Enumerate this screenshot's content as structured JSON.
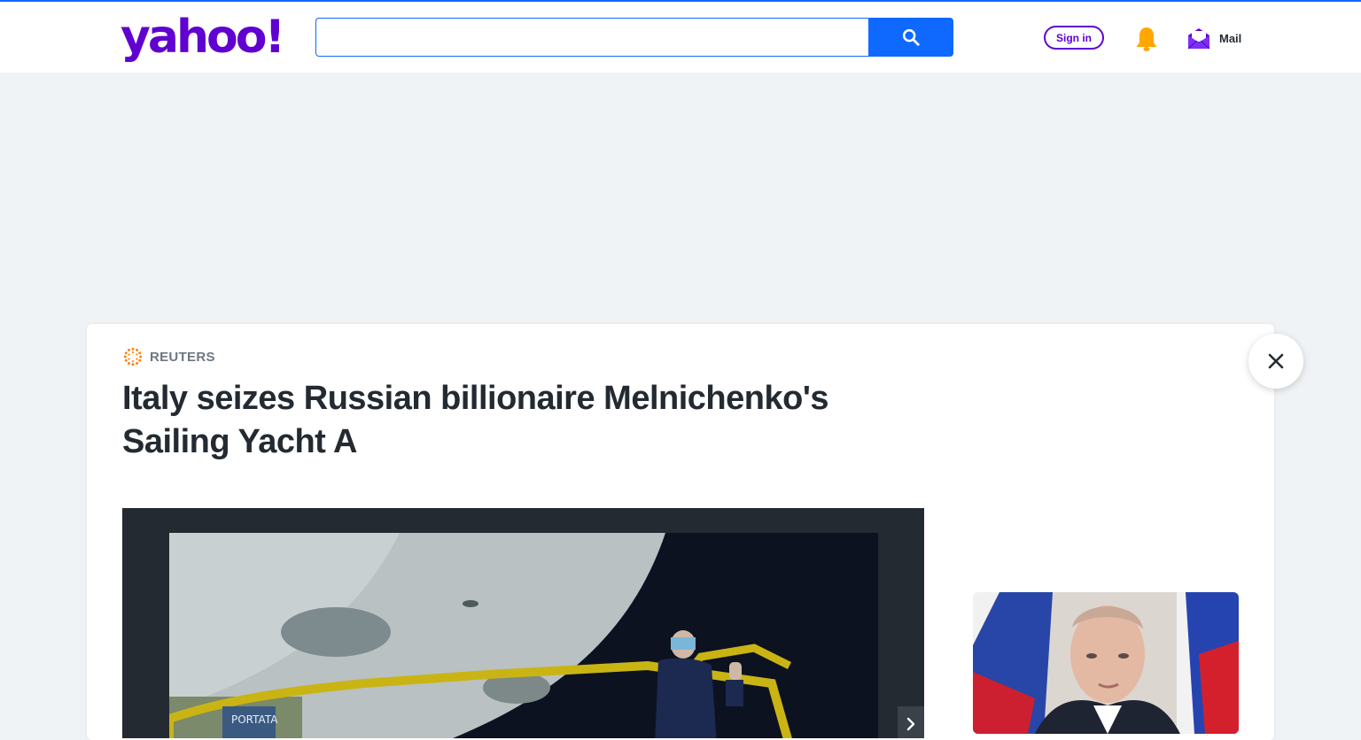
{
  "header": {
    "logo_text": "yahoo!",
    "search": {
      "placeholder": "",
      "value": ""
    },
    "signin_label": "Sign in",
    "mail_label": "Mail",
    "brand_color": "#6001d2",
    "accent_color": "#0f69ff",
    "icons": [
      "search-icon",
      "bell-icon",
      "mail-icon"
    ]
  },
  "article": {
    "publisher": "REUTERS",
    "title": "Italy seizes Russian billionaire Melnichenko's Sailing Yacht A"
  },
  "media": {
    "photo_alt": "",
    "icons": [
      "chevron-right-icon",
      "close-icon"
    ]
  }
}
